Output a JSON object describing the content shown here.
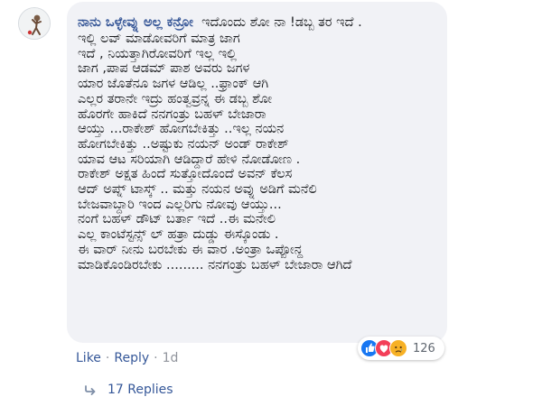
{
  "comment": {
    "author": "ನಾನು ಒಳ್ಳೇವ್ನು ಅಲ್ಲ ಕನ್ರೋ",
    "lines": [
      "ಇದೊಂದು ಶೋ ನಾ !ಡಬ್ಬ ತರ ಇದೆ .",
      "ಇಲ್ಲಿ ಲವ್ ಮಾಡೋವರಿಗೆ ಮಾತ್ರ ಜಾಗ",
      "ಇದೆ , ನಿಯತ್ತಾಗಿರೋವರಿಗೆ ಇಲ್ಲ ಇಲ್ಲಿ",
      "ಜಾಗ ,ಪಾಪ ಆಡಮ್ ಪಾಶ ಅವರು ಜಗಳ",
      "ಯಾರ ಜೊತೆನೂ ಜಗಳ ಆಡಿಲ್ಲ ..ಫ್ರಾಂಕ್ ಆಗಿ",
      "ಎಲ್ಲರ ತರಾನೇ ಇದ್ರು ಹಂತ್ವವ್ರನ್ನ ಈ ಡಬ್ಬ ಶೋ",
      "ಹೊರಗೇ ಹಾಕಿದೆ ನನಗಂತ್ರು ಬಹಳ್ ಬೇಜಾರಾ",
      "ಆಯ್ತು ...ರಾಕೇಶ್ ಹೋಗಬೇಕಿತ್ತು ..ಇಲ್ಲ ನಯನ",
      "ಹೋಗಬೇಕಿತ್ತು ..ಅಷ್ಟುಕು ನಯನ್ ಅಂಡ್ ರಾಕೇಶ್",
      "ಯಾವ ಆಟ ಸರಿಯಾಗಿ ಆಡಿದ್ದಾರೆ ಹೇಳಿ ನೋಡೋಣ .",
      "ರಾಕೇಶ್ ಅಕ್ಷತ ಹಿಂದೆ ಸುತ್ತೋದೊಂದೆ ಅವನ್ ಕೆಲಸ",
      "ಆದ್ ಅಪ್ನ್ ಟಾಸ್ಕ್ .. ಮತ್ತು ನಯನ ಅವ್ನು ಅಡಿಗೆ ಮನೆಲಿ",
      "ಬೇಜವಾಬ್ದಾರಿ ಇಂದ ಎಲ್ಲರಿಗು ನೋವು ಆಯ್ತು...",
      "ನಂಗೆ ಬಹಳ್ ಡೌಟ್ ಬರ್ತಾ ಇದೆ ..ಈ ಮನೇಲಿ",
      "ಎಲ್ಲ ಕಾಂಟೆಸ್ಟನ್ಸ್ ಲ್ ಹತ್ರಾ ದುಡ್ಡು ಈಸ್ಕೊಂಡು .",
      "ಈ ವಾರ್ ನೀನು ಬರಬೇಕು ಈ ವಾರ .ಅಂತ್ರಾ ಒಪ್ಪೋನ್ದ",
      "ಮಾಡಿಕೊಂಡಿರಬೇಕು ......... ನನಗಂತ್ರು ಬಹಳ್ ಬೇಜಾರಾ ಆಗಿದೆ"
    ]
  },
  "reactions": {
    "icons": [
      "like-icon",
      "love-icon",
      "sad-icon"
    ],
    "count": "126",
    "colors": {
      "like": "#1877f2",
      "love": "#f33e58",
      "sad": "#f7b125"
    }
  },
  "actions": {
    "like_label": "Like",
    "separator": "·",
    "reply_label": "Reply",
    "timestamp": "1d"
  },
  "replies": {
    "label": "17 Replies",
    "icon": "reply-arrow-icon"
  },
  "colors": {
    "author": "#385898",
    "link": "#365899",
    "bubble": "#f1f2f6",
    "meta": "#606770"
  }
}
